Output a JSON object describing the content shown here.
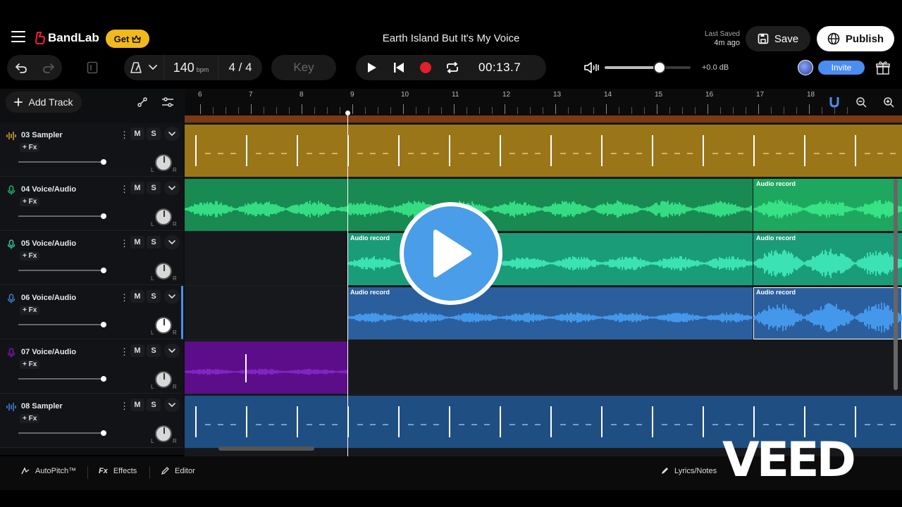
{
  "header": {
    "brand": "BandLab",
    "get_label": "Get",
    "project_title": "Earth Island But It's My Voice",
    "saved_label": "Last Saved",
    "saved_time": "4m ago",
    "save_label": "Save",
    "publish_label": "Publish"
  },
  "transport": {
    "bpm": "140",
    "bpm_unit": "bpm",
    "time_signature": "4 / 4",
    "key_label": "Key",
    "time": "00:13.7",
    "master_gain": "+0.0 dB",
    "master_volume_fraction": 0.64,
    "invite_label": "Invite"
  },
  "panel": {
    "add_track_label": "Add Track",
    "fx_label": "+ Fx",
    "mute_label": "M",
    "solo_label": "S",
    "left_label": "L",
    "right_label": "R"
  },
  "tracks": [
    {
      "name": "03  Sampler",
      "type": "sampler",
      "color": "#b68a1e",
      "volume_fraction": 1.0
    },
    {
      "name": "04  Voice/Audio",
      "type": "voice",
      "color": "#1fb56a",
      "volume_fraction": 1.0
    },
    {
      "name": "05  Voice/Audio",
      "type": "voice",
      "color": "#25d39b",
      "volume_fraction": 1.0
    },
    {
      "name": "06  Voice/Audio",
      "type": "voice",
      "color": "#3a7fd4",
      "volume_fraction": 1.0
    },
    {
      "name": "07  Voice/Audio",
      "type": "voice",
      "color": "#7d12b8",
      "volume_fraction": 1.0
    },
    {
      "name": "08  Sampler",
      "type": "sampler",
      "color": "#2a6fb8",
      "volume_fraction": 1.0
    }
  ],
  "ruler": {
    "bars": [
      "6",
      "7",
      "8",
      "9",
      "10",
      "11",
      "12",
      "13",
      "14",
      "15",
      "16",
      "17",
      "18"
    ]
  },
  "regions": {
    "audio_record_label": "Audio record"
  },
  "bottom": {
    "autopitch_label": "AutoPitch™",
    "effects_label": "Effects",
    "editor_label": "Editor",
    "lyrics_label": "Lyrics/Notes"
  },
  "watermark": {
    "text": "VEED"
  },
  "colors": {
    "accent_blue": "#4b8df0",
    "record_red": "#e0202a",
    "get_yellow": "#f2b91d"
  }
}
